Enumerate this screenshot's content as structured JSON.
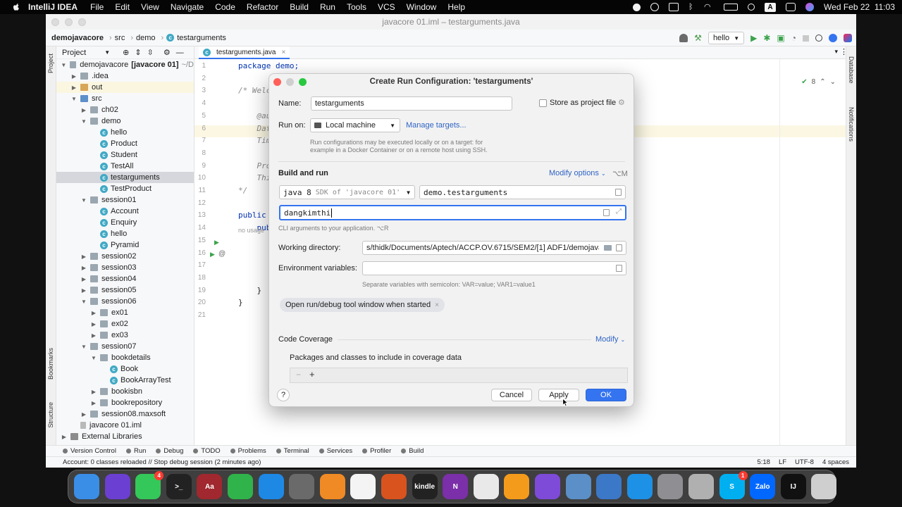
{
  "menubar": {
    "app_name": "IntelliJ IDEA",
    "items": [
      "File",
      "Edit",
      "View",
      "Navigate",
      "Code",
      "Refactor",
      "Build",
      "Run",
      "Tools",
      "VCS",
      "Window",
      "Help"
    ],
    "input_badge": "A",
    "datetime": "Wed Feb 22  11:03"
  },
  "window": {
    "title": "javacore 01.iml – testarguments.java",
    "breadcrumbs": [
      "demojavacore",
      "src",
      "demo",
      "testarguments"
    ],
    "run_config": "hello"
  },
  "project_panel": {
    "title": "Project",
    "tree": [
      {
        "label": "demojavacore",
        "bold_suffix": "[javacore 01]",
        "suffix": "~/D",
        "type": "module",
        "depth": 0,
        "expanded": true
      },
      {
        "label": ".idea",
        "type": "folder",
        "depth": 1,
        "expanded": false
      },
      {
        "label": "out",
        "type": "folder-excluded",
        "depth": 1,
        "expanded": false,
        "highlight": true
      },
      {
        "label": "src",
        "type": "folder-src",
        "depth": 1,
        "expanded": true
      },
      {
        "label": "ch02",
        "type": "package",
        "depth": 2,
        "expanded": false
      },
      {
        "label": "demo",
        "type": "package",
        "depth": 2,
        "expanded": true
      },
      {
        "label": "hello",
        "type": "class",
        "depth": 3
      },
      {
        "label": "Product",
        "type": "class",
        "depth": 3
      },
      {
        "label": "Student",
        "type": "class",
        "depth": 3
      },
      {
        "label": "TestAll",
        "type": "class",
        "depth": 3
      },
      {
        "label": "testarguments",
        "type": "class",
        "depth": 3,
        "selected": true
      },
      {
        "label": "TestProduct",
        "type": "class",
        "depth": 3
      },
      {
        "label": "session01",
        "type": "package",
        "depth": 2,
        "expanded": true
      },
      {
        "label": "Account",
        "type": "class",
        "depth": 3
      },
      {
        "label": "Enquiry",
        "type": "class",
        "depth": 3
      },
      {
        "label": "hello",
        "type": "class",
        "depth": 3
      },
      {
        "label": "Pyramid",
        "type": "class",
        "depth": 3
      },
      {
        "label": "session02",
        "type": "package",
        "depth": 2,
        "expanded": false
      },
      {
        "label": "session03",
        "type": "package",
        "depth": 2,
        "expanded": false
      },
      {
        "label": "session04",
        "type": "package",
        "depth": 2,
        "expanded": false
      },
      {
        "label": "session05",
        "type": "package",
        "depth": 2,
        "expanded": false
      },
      {
        "label": "session06",
        "type": "package",
        "depth": 2,
        "expanded": true
      },
      {
        "label": "ex01",
        "type": "package",
        "depth": 3,
        "expanded": false
      },
      {
        "label": "ex02",
        "type": "package",
        "depth": 3,
        "expanded": false
      },
      {
        "label": "ex03",
        "type": "package",
        "depth": 3,
        "expanded": false
      },
      {
        "label": "session07",
        "type": "package",
        "depth": 2,
        "expanded": true
      },
      {
        "label": "bookdetails",
        "type": "package",
        "depth": 3,
        "expanded": true
      },
      {
        "label": "Book",
        "type": "class",
        "depth": 4
      },
      {
        "label": "BookArrayTest",
        "type": "class",
        "depth": 4
      },
      {
        "label": "bookisbn",
        "type": "package",
        "depth": 3,
        "expanded": false
      },
      {
        "label": "bookrepository",
        "type": "package",
        "depth": 3,
        "expanded": false
      },
      {
        "label": "session08.maxsoft",
        "type": "package",
        "depth": 2,
        "expanded": false
      },
      {
        "label": "javacore 01.iml",
        "type": "file",
        "depth": 1
      },
      {
        "label": "External Libraries",
        "type": "library",
        "depth": 0,
        "expanded": false
      }
    ]
  },
  "editor": {
    "tab": "testarguments.java",
    "warnings": "8",
    "lines": [
      {
        "n": "1",
        "text": "package demo;"
      },
      {
        "n": "2",
        "text": ""
      },
      {
        "n": "3",
        "text": "/* Welc"
      },
      {
        "n": "4",
        "text": ""
      },
      {
        "n": "5",
        "text": "    @aut"
      },
      {
        "n": "6",
        "text": "    Date"
      },
      {
        "n": "7",
        "text": "    Time"
      },
      {
        "n": "8",
        "text": ""
      },
      {
        "n": "9",
        "text": "    Proj"
      },
      {
        "n": "10",
        "text": "    Thi"
      },
      {
        "n": "11",
        "text": "*/"
      },
      {
        "n": "12",
        "text": ""
      },
      {
        "n": "13",
        "text": "public"
      },
      {
        "n": "14",
        "text": "    pub"
      },
      {
        "n": "15",
        "text": ""
      },
      {
        "n": "16",
        "text": ""
      },
      {
        "n": "17",
        "text": ""
      },
      {
        "n": "18",
        "text": ""
      },
      {
        "n": "19",
        "text": "    }"
      },
      {
        "n": "20",
        "text": "}"
      },
      {
        "n": "21",
        "text": ""
      }
    ],
    "inlay_hint": "no usage"
  },
  "dialog": {
    "title": "Create Run Configuration: 'testarguments'",
    "name_label": "Name:",
    "name_value": "testarguments",
    "store_label": "Store as project file",
    "run_on_label": "Run on:",
    "run_on_value": "Local machine",
    "manage_targets": "Manage targets...",
    "run_on_hint_1": "Run configurations may be executed locally or on a target: for",
    "run_on_hint_2": "example in a Docker Container or on a remote host using SSH.",
    "build_and_run": "Build and run",
    "modify_options": "Modify options",
    "modify_shortcut": "⌥M",
    "jdk_version": "java 8",
    "jdk_hint": "SDK of 'javacore 01'",
    "main_class": "demo.testarguments",
    "program_args": "dangkimthi",
    "args_hint": "CLI arguments to your application. ⌥R",
    "working_dir_label": "Working directory:",
    "working_dir_value": "s/thidk/Documents/Aptech/ACCP.OV.6715/SEM2/[1] ADF1/demojavac",
    "env_label": "Environment variables:",
    "env_value": "",
    "env_hint": "Separate variables with semicolon: VAR=value; VAR1=value1",
    "chip_label": "Open run/debug tool window when started",
    "code_coverage": "Code Coverage",
    "modify": "Modify",
    "packages_label": "Packages and classes to include in coverage data",
    "cancel": "Cancel",
    "apply": "Apply",
    "ok": "OK",
    "help": "?"
  },
  "bottom_tools": [
    "Version Control",
    "Run",
    "Debug",
    "TODO",
    "Problems",
    "Terminal",
    "Services",
    "Profiler",
    "Build"
  ],
  "status": {
    "message": "Account: 0 classes reloaded // Stop debug session (2 minutes ago)",
    "position": "5:18",
    "line_sep": "LF",
    "encoding": "UTF-8",
    "indent": "4 spaces"
  },
  "side_labels": {
    "left": [
      "Project",
      "Bookmarks",
      "Structure"
    ],
    "right": [
      "Database",
      "Notifications"
    ]
  },
  "dock": {
    "apps": [
      {
        "icon": "finder-icon",
        "color": "#3a8ee6",
        "label": ""
      },
      {
        "icon": "siri-icon",
        "color": "#6b3fd1",
        "label": ""
      },
      {
        "icon": "messages-icon",
        "color": "#34c759",
        "label": "",
        "badge": "4"
      },
      {
        "icon": "terminal-icon",
        "color": "#222222",
        "label": ">_"
      },
      {
        "icon": "dictionary-icon",
        "color": "#a0282e",
        "label": "Aa"
      },
      {
        "icon": "numbers-icon",
        "color": "#2fb34a",
        "label": ""
      },
      {
        "icon": "safari-icon",
        "color": "#1e88e5",
        "label": ""
      },
      {
        "icon": "launchpad-icon",
        "color": "#6a6a6a",
        "label": ""
      },
      {
        "icon": "books-icon",
        "color": "#f08a24",
        "label": ""
      },
      {
        "icon": "photos-icon",
        "color": "#f4f4f4",
        "label": ""
      },
      {
        "icon": "reeder-icon",
        "color": "#d9531e",
        "label": ""
      },
      {
        "icon": "kindle-icon",
        "color": "#222222",
        "label": "kindle"
      },
      {
        "icon": "onenote-icon",
        "color": "#7b2fa8",
        "label": "N"
      },
      {
        "icon": "keyboard-icon",
        "color": "#e9e9e9",
        "label": ""
      },
      {
        "icon": "pages-icon",
        "color": "#f59b1b",
        "label": ""
      },
      {
        "icon": "github-icon",
        "color": "#7e4bd8",
        "label": ""
      },
      {
        "icon": "preview-icon",
        "color": "#5b8fc7",
        "label": ""
      },
      {
        "icon": "network-icon",
        "color": "#3c78c8",
        "label": ""
      },
      {
        "icon": "docker-icon",
        "color": "#1d91e6",
        "label": ""
      },
      {
        "icon": "system-preferences-icon",
        "color": "#8e8e93",
        "label": ""
      },
      {
        "icon": "database-icon",
        "color": "#b0b0b0",
        "label": ""
      },
      {
        "icon": "skype-icon",
        "color": "#00aff0",
        "label": "S",
        "badge": "1"
      },
      {
        "icon": "zalo-icon",
        "color": "#0068ff",
        "label": "Zalo"
      },
      {
        "icon": "intellij-icon",
        "color": "#111111",
        "label": "IJ"
      },
      {
        "icon": "trash-icon",
        "color": "#cfcfcf",
        "label": ""
      }
    ]
  }
}
